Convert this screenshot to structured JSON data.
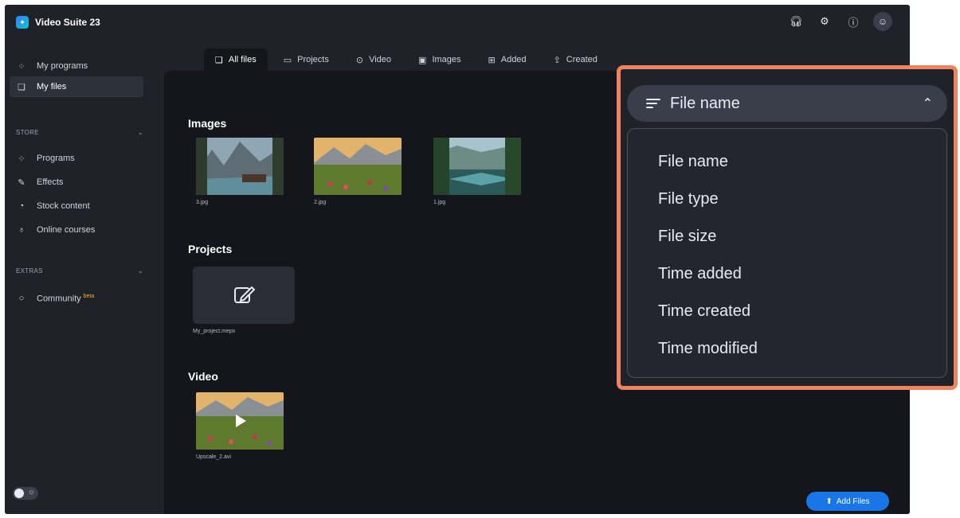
{
  "app": {
    "title": "Video Suite 23"
  },
  "sidebar": {
    "top_items": [
      {
        "label": "My programs",
        "icon": "grid-icon"
      },
      {
        "label": "My files",
        "icon": "files-icon",
        "active": true
      }
    ],
    "store": {
      "header": "STORE",
      "items": [
        {
          "label": "Programs",
          "icon": "grid-icon"
        },
        {
          "label": "Effects",
          "icon": "effects-icon"
        },
        {
          "label": "Stock content",
          "icon": "pie-icon"
        },
        {
          "label": "Online courses",
          "icon": "location-icon"
        }
      ]
    },
    "extras": {
      "header": "EXTRAS",
      "items": [
        {
          "label": "Community",
          "badge": "beta",
          "icon": "chat-icon"
        }
      ]
    }
  },
  "tabs": [
    {
      "label": "All files",
      "active": true
    },
    {
      "label": "Projects"
    },
    {
      "label": "Video"
    },
    {
      "label": "Images"
    },
    {
      "label": "Added"
    },
    {
      "label": "Created"
    }
  ],
  "groups": {
    "images": {
      "title": "Images",
      "files": [
        "3.jpg",
        "2.jpg",
        "1.jpg"
      ]
    },
    "projects": {
      "title": "Projects",
      "files": [
        "My_project.mepx"
      ]
    },
    "video": {
      "title": "Video",
      "files": [
        "Upscale_2.avi"
      ]
    }
  },
  "add_files_label": "Add Files",
  "sort": {
    "selected": "File name",
    "options": [
      "File name",
      "File type",
      "File size",
      "Time added",
      "Time created",
      "Time modified"
    ]
  },
  "colors": {
    "accent": "#1976e8",
    "highlight": "#f0835f",
    "background": "#1f2229"
  }
}
